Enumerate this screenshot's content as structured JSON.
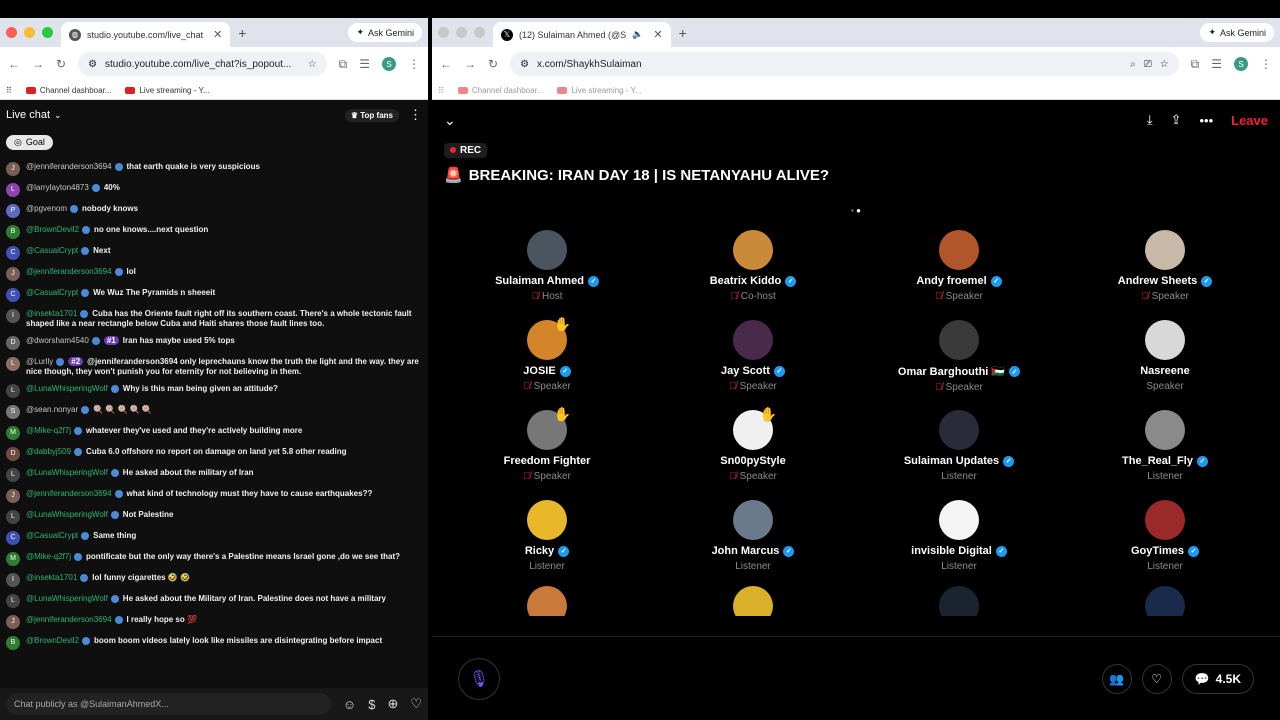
{
  "left_window": {
    "tab_title": "studio.youtube.com/live_chat",
    "url": "studio.youtube.com/live_chat?is_popout...",
    "ask_gemini": "Ask Gemini",
    "profile_initial": "S",
    "bookmarks": [
      "Channel dashboar...",
      "Live streaming - Y..."
    ]
  },
  "chat": {
    "title": "Live chat",
    "top_fans": "Top fans",
    "goal": "Goal",
    "input_placeholder": "Chat publicly as @SulaimanAhmedX...",
    "messages": [
      {
        "initial": "J",
        "color": "#7b5e57",
        "author": "@jenniferanderson3694",
        "green": false,
        "rank": "",
        "text": "that earth quake is very suspicious"
      },
      {
        "initial": "L",
        "color": "#8e44ad",
        "author": "@larrylayton4873",
        "green": false,
        "rank": "",
        "text": "40%"
      },
      {
        "initial": "P",
        "color": "#5c6bc0",
        "author": "@pgvenom",
        "green": false,
        "rank": "",
        "text": "nobody knows"
      },
      {
        "initial": "B",
        "color": "#2e7d32",
        "author": "@BrownDevil2",
        "green": true,
        "rank": "",
        "text": "no one knows....next question"
      },
      {
        "initial": "C",
        "color": "#3f51b5",
        "author": "@CasualCrypt",
        "green": true,
        "rank": "",
        "text": "Next"
      },
      {
        "initial": "J",
        "color": "#7b5e57",
        "author": "@jenniferanderson3694",
        "green": true,
        "rank": "",
        "text": "lol"
      },
      {
        "initial": "C",
        "color": "#3f51b5",
        "author": "@CasualCrypt",
        "green": true,
        "rank": "",
        "text": "We Wuz The Pyramids n sheeeit"
      },
      {
        "initial": "I",
        "color": "#555555",
        "author": "@insekta1701",
        "green": true,
        "rank": "",
        "text": "Cuba has the Oriente fault right off its southern coast. There's a whole tectonic fault shaped like a near rectangle below Cuba and Haiti shares those fault lines too."
      },
      {
        "initial": "D",
        "color": "#666666",
        "author": "@dworsham4540",
        "green": false,
        "rank": "#1",
        "text": "Iran has maybe used 5% tops"
      },
      {
        "initial": "L",
        "color": "#8d6e63",
        "author": "@Lurlly",
        "green": false,
        "rank": "#2",
        "text": "@jenniferanderson3694 only leprechauns know the truth the light and the way. they are nice though, they won't punish you for eternity for not believing in them."
      },
      {
        "initial": "L",
        "color": "#444444",
        "author": "@LunaWhisperingWolf",
        "green": true,
        "rank": "",
        "text": "Why is this man being given an attitude?"
      },
      {
        "initial": "S",
        "color": "#777777",
        "author": "@sean.nonyar",
        "green": false,
        "rank": "",
        "text": "🍭 🍭 🍭 🍭 🍭"
      },
      {
        "initial": "M",
        "color": "#2e7d32",
        "author": "@Mike-q2f7j",
        "green": true,
        "rank": "",
        "text": "whatever they've used and they're actively building more"
      },
      {
        "initial": "D",
        "color": "#6d4c41",
        "author": "@dabbyj509",
        "green": true,
        "rank": "",
        "text": "Cuba 6.0 offshore no report on damage on land yet 5.8 other reading"
      },
      {
        "initial": "L",
        "color": "#444444",
        "author": "@LunaWhisperingWolf",
        "green": true,
        "rank": "",
        "text": "He asked about the military of Iran"
      },
      {
        "initial": "J",
        "color": "#7b5e57",
        "author": "@jenniferanderson3694",
        "green": true,
        "rank": "",
        "text": "what kind of technology must they have to cause earthquakes??"
      },
      {
        "initial": "L",
        "color": "#444444",
        "author": "@LunaWhisperingWolf",
        "green": true,
        "rank": "",
        "text": "Not Palestine"
      },
      {
        "initial": "C",
        "color": "#3f51b5",
        "author": "@CasualCrypt",
        "green": true,
        "rank": "",
        "text": "Same thing"
      },
      {
        "initial": "M",
        "color": "#2e7d32",
        "author": "@Mike-q2f7j",
        "green": true,
        "rank": "",
        "text": "pontificate but the only way there's a Palestine means Israel gone ,do we see that?"
      },
      {
        "initial": "I",
        "color": "#555555",
        "author": "@insekta1701",
        "green": true,
        "rank": "",
        "text": "lol funny cigarettes 🤣 🤣"
      },
      {
        "initial": "L",
        "color": "#444444",
        "author": "@LunaWhisperingWolf",
        "green": true,
        "rank": "",
        "text": "He asked about the Military of Iran. Palestine does not have a military"
      },
      {
        "initial": "J",
        "color": "#7b5e57",
        "author": "@jenniferanderson3694",
        "green": true,
        "rank": "",
        "text": "I really hope so 💯"
      },
      {
        "initial": "B",
        "color": "#2e7d32",
        "author": "@BrownDevil2",
        "green": true,
        "rank": "",
        "text": "boom boom videos lately look like missiles are disintegrating before impact"
      }
    ]
  },
  "right_window": {
    "tab_title": "(12) Sulaiman Ahmed (@S",
    "url": "x.com/ShaykhSulaiman",
    "ask_gemini": "Ask Gemini",
    "profile_initial": "S",
    "bookmarks": [
      "Channel dashboar...",
      "Live streaming - Y..."
    ]
  },
  "space": {
    "leave": "Leave",
    "rec": "REC",
    "title": "BREAKING: IRAN DAY 18 | IS NETANYAHU ALIVE?",
    "listener_count": "4.5K",
    "speakers": [
      {
        "name": "Sulaiman Ahmed",
        "verified": true,
        "role": "Host",
        "muted": true,
        "hand": false,
        "color": "#4a5560"
      },
      {
        "name": "Beatrix Kiddo",
        "verified": true,
        "role": "Co-host",
        "muted": true,
        "hand": false,
        "color": "#c98a3a"
      },
      {
        "name": "Andy froemel",
        "verified": true,
        "role": "Speaker",
        "muted": true,
        "hand": false,
        "color": "#b0562a"
      },
      {
        "name": "Andrew Sheets",
        "verified": true,
        "role": "Speaker",
        "muted": true,
        "hand": false,
        "color": "#c7b8a8"
      },
      {
        "name": "JOSIE",
        "verified": true,
        "role": "Speaker",
        "muted": true,
        "hand": true,
        "color": "#d4842a"
      },
      {
        "name": "Jay Scott",
        "verified": true,
        "role": "Speaker",
        "muted": true,
        "hand": false,
        "color": "#4a2a4a"
      },
      {
        "name": "Omar Barghouthi 🇵🇸",
        "verified": true,
        "role": "Speaker",
        "muted": true,
        "hand": false,
        "color": "#3a3a3a"
      },
      {
        "name": "Nasreene",
        "verified": false,
        "role": "Speaker",
        "muted": false,
        "hand": false,
        "color": "#d8d8d8"
      },
      {
        "name": "Freedom Fighter",
        "verified": false,
        "role": "Speaker",
        "muted": true,
        "hand": true,
        "color": "#777777"
      },
      {
        "name": "Sn00pyStyle",
        "verified": false,
        "role": "Speaker",
        "muted": true,
        "hand": true,
        "color": "#f0f0f0"
      },
      {
        "name": "Sulaiman Updates",
        "verified": true,
        "role": "Listener",
        "muted": false,
        "hand": false,
        "color": "#2a2a3a"
      },
      {
        "name": "The_Real_Fly",
        "verified": true,
        "role": "Listener",
        "muted": false,
        "hand": false,
        "color": "#8a8a8a"
      },
      {
        "name": "Ricky",
        "verified": true,
        "role": "Listener",
        "muted": false,
        "hand": false,
        "color": "#e8b82a"
      },
      {
        "name": "John Marcus",
        "verified": true,
        "role": "Listener",
        "muted": false,
        "hand": false,
        "color": "#6a7a8a"
      },
      {
        "name": "invisible Digital",
        "verified": true,
        "role": "Listener",
        "muted": false,
        "hand": false,
        "color": "#f5f5f5"
      },
      {
        "name": "GoyTimes",
        "verified": true,
        "role": "Listener",
        "muted": false,
        "hand": false,
        "color": "#9a2a2a"
      }
    ],
    "partial_colors": [
      "#c97a3a",
      "#d8b02a",
      "#1a2330",
      "#1a2a4a"
    ]
  }
}
